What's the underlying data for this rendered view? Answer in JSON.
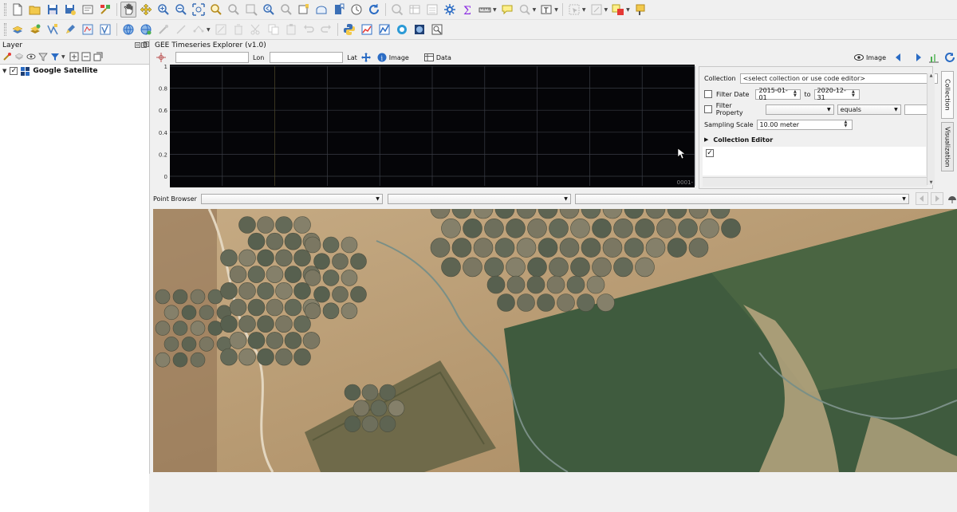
{
  "toolbar_row1": [
    "new-project-icon",
    "open-project-icon",
    "save-project-icon",
    "save-as-icon",
    "print-layout-icon",
    "style-manager-icon",
    "pan-icon",
    "pan-to-selection-icon",
    "zoom-in-icon",
    "zoom-out-icon",
    "zoom-full-icon",
    "zoom-layer-icon",
    "zoom-selection-icon",
    "zoom-native-icon",
    "zoom-last-icon",
    "zoom-next-icon",
    "new-bookmark-icon",
    "show-bookmarks-icon",
    "refresh-icon",
    "identify-icon",
    "attribute-table-icon",
    "field-calculator-icon",
    "processing-toolbox-icon",
    "statistics-icon",
    "measure-icon",
    "map-tips-icon",
    "select-feature-icon",
    "text-annotation-icon",
    "select-by-value-icon",
    "deselect-icon",
    "label-icon",
    "highlight-icon"
  ],
  "toolbar_row2": [
    "add-layer-icon",
    "add-vector-icon",
    "digitize-icon",
    "edit-pencil-icon",
    "save-edits-icon",
    "vertex-icon",
    "add-feature-icon",
    "move-feature-icon",
    "node-tool-icon",
    "delete-selected-icon",
    "cut-icon",
    "copy-icon",
    "paste-icon",
    "undo-icon",
    "redo-icon",
    "python-icon",
    "plugin-a-icon",
    "plugin-b-icon",
    "plugin-c-icon",
    "plugin-d-icon",
    "plugin-e-icon"
  ],
  "layer_panel": {
    "title": "Layer",
    "layers": [
      {
        "name": "Google Satellite",
        "checked": true
      }
    ]
  },
  "gee": {
    "title": "GEE Timeseries Explorer (v1.0)",
    "lon_label": "Lon",
    "lat_label": "Lat",
    "image_label": "Image",
    "data_label": "Data",
    "image_nav_label": "Image",
    "collection_label": "Collection",
    "collection_placeholder": "<select collection or use code editor>",
    "filter_date_label": "Filter Date",
    "date_from": "2015-01-01",
    "to_label": "to",
    "date_to": "2020-12-31",
    "filter_property_label": "Filter Property",
    "property_op": "equals",
    "sampling_scale_label": "Sampling Scale",
    "sampling_scale": "10.00 meter",
    "collection_editor_label": "Collection Editor",
    "tabs": [
      "Collection",
      "Visualization"
    ],
    "point_browser_label": "Point Browser"
  },
  "chart_data": {
    "type": "line",
    "series": [],
    "y_ticks": [
      "0",
      "0.2",
      "0.4",
      "0.6",
      "0.8",
      "1"
    ],
    "ylim": [
      0,
      1
    ],
    "x_tick_label": "0001-",
    "grid": true
  },
  "colors": {
    "plot_bg": "#050508",
    "grid": "#3a3d45",
    "accent": "#2b6cc4"
  }
}
